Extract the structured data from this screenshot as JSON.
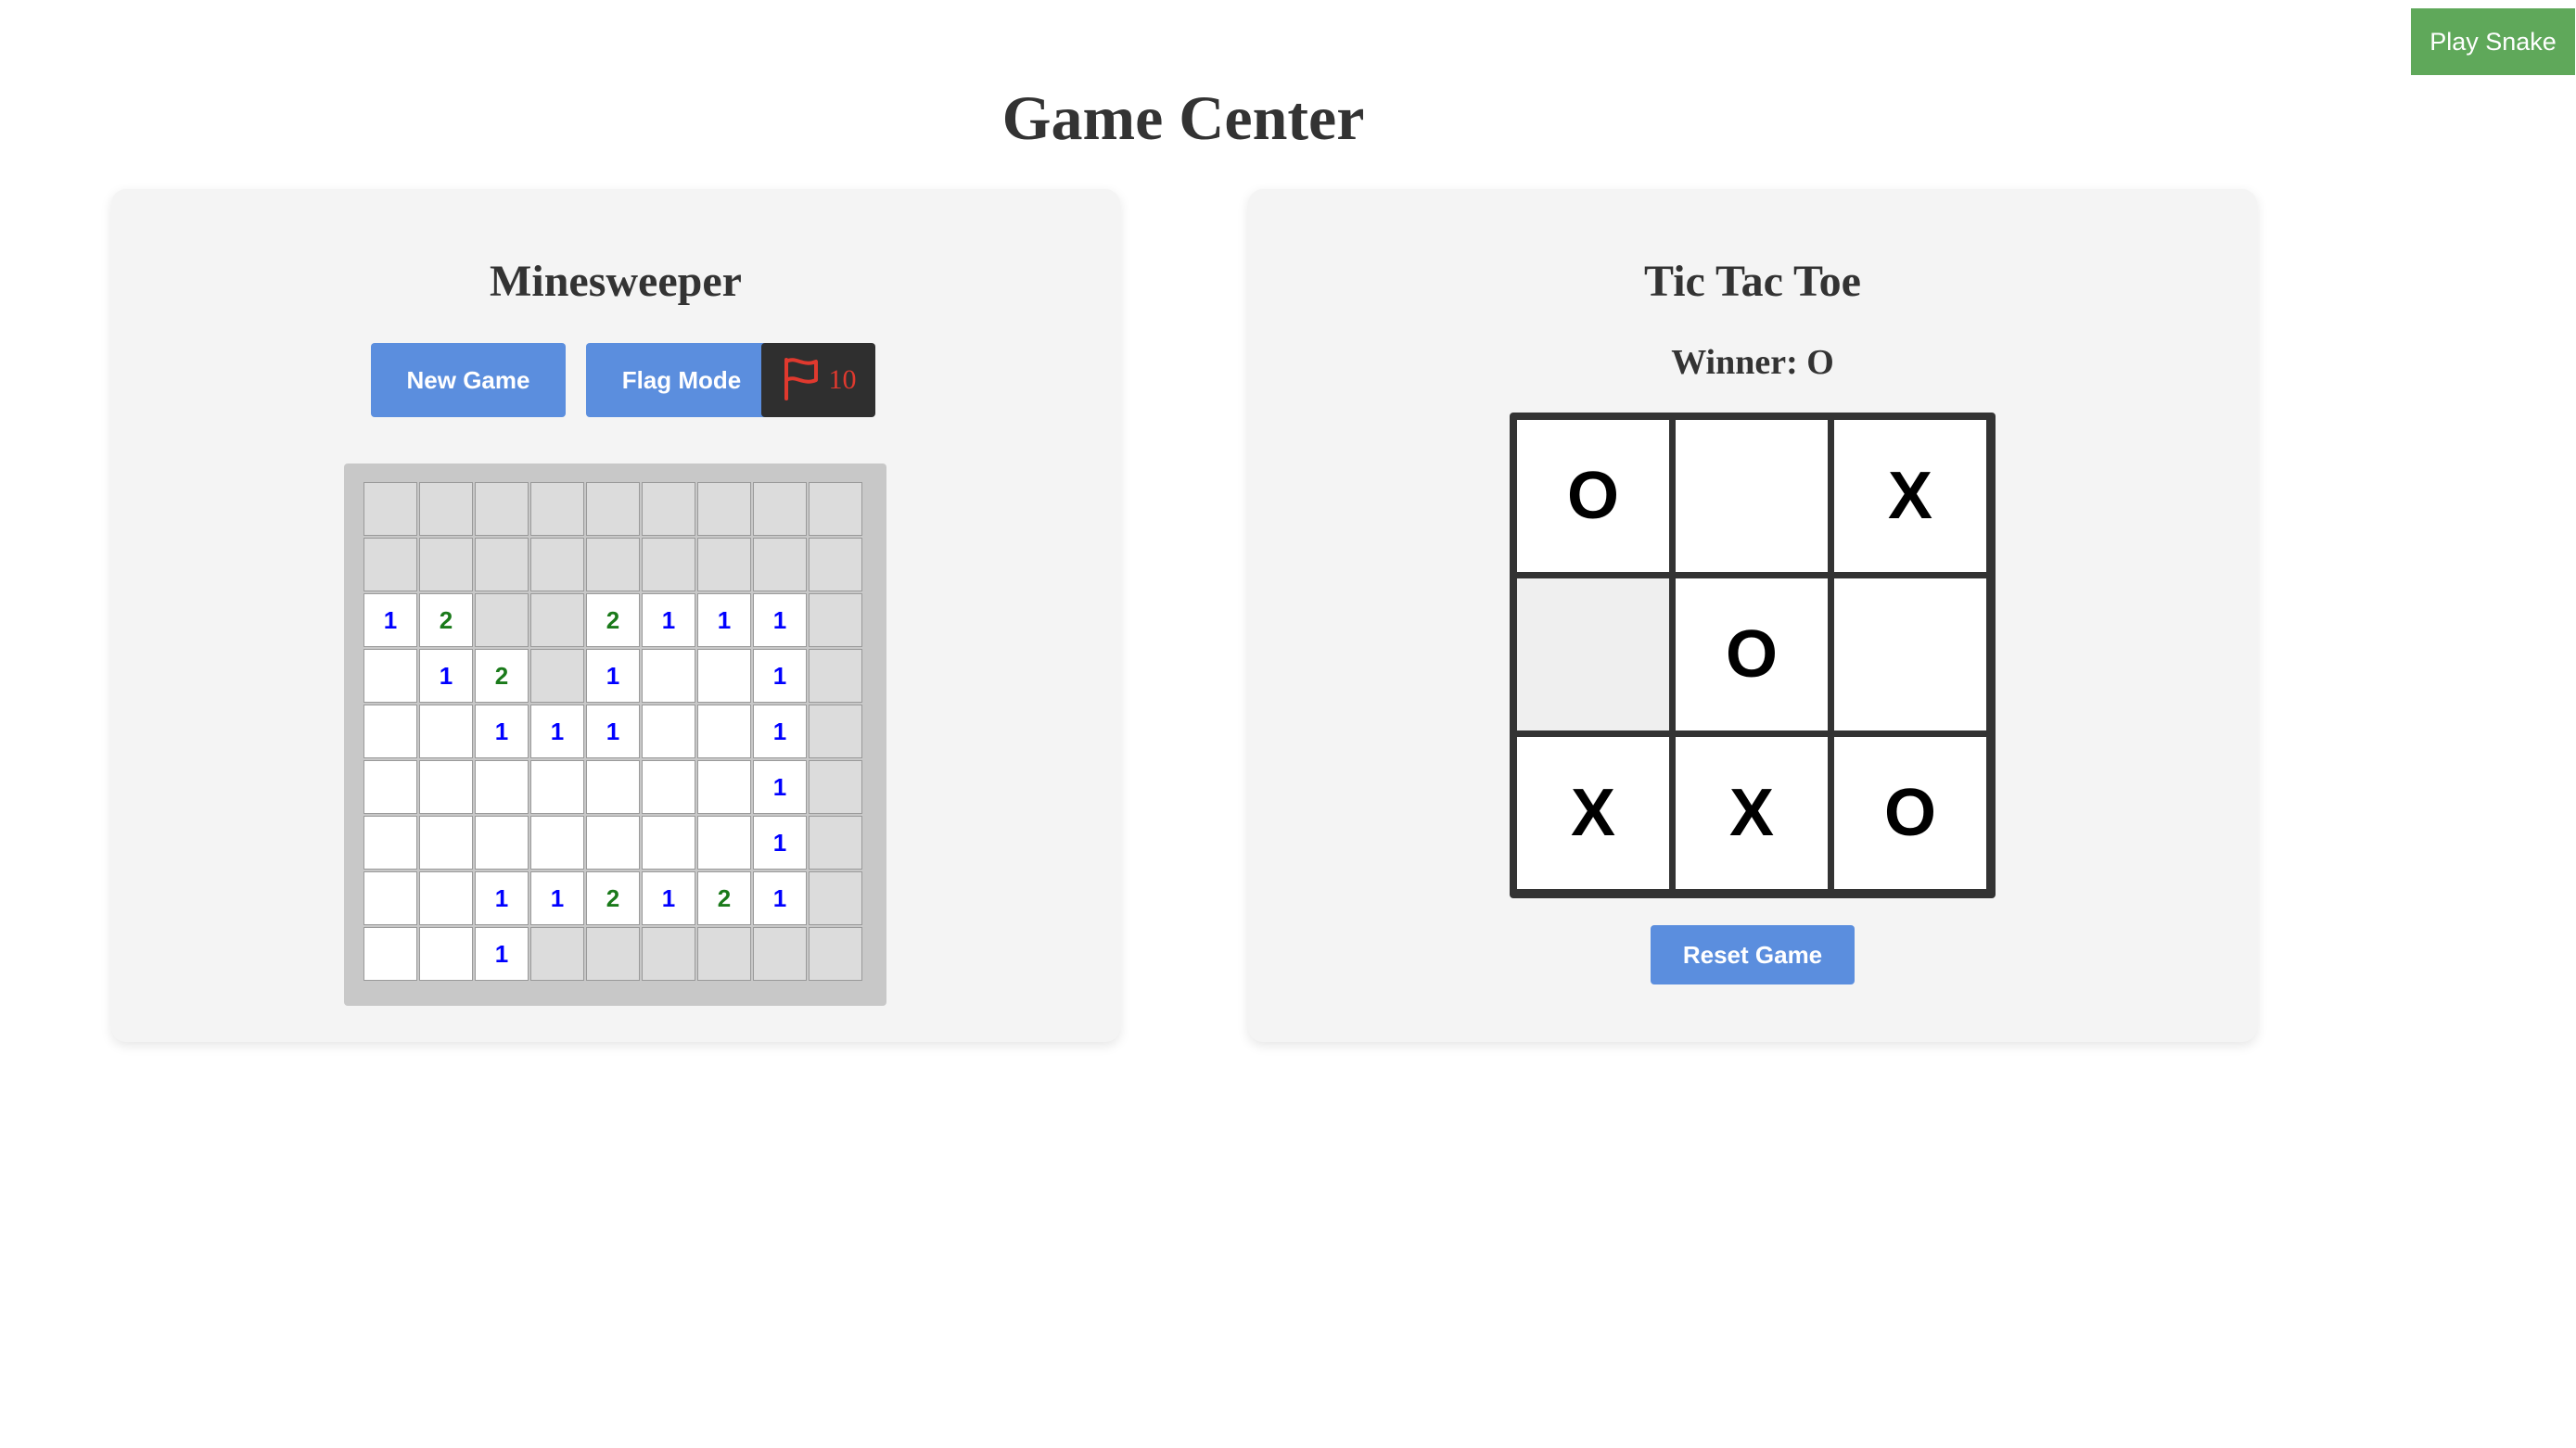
{
  "header": {
    "title": "Game Center",
    "play_snake_label": "Play Snake"
  },
  "minesweeper": {
    "title": "Minesweeper",
    "new_game_label": "New Game",
    "flag_mode_label": "Flag Mode",
    "flag_icon": "flag-icon",
    "flag_count": "10",
    "number_colors": {
      "1": "#0000ff",
      "2": "#1a7a1a"
    },
    "board": [
      [
        "h",
        "h",
        "h",
        "h",
        "h",
        "h",
        "h",
        "h",
        "h"
      ],
      [
        "h",
        "h",
        "h",
        "h",
        "h",
        "h",
        "h",
        "h",
        "h"
      ],
      [
        "1",
        "2",
        "h",
        "h",
        "2",
        "1",
        "1",
        "1",
        "h"
      ],
      [
        "",
        "1",
        "2",
        "h",
        "1",
        "",
        "",
        "1",
        "h"
      ],
      [
        "",
        "",
        "1",
        "1",
        "1",
        "",
        "",
        "1",
        "h"
      ],
      [
        "",
        "",
        "",
        "",
        "",
        "",
        "",
        "1",
        "h"
      ],
      [
        "",
        "",
        "",
        "",
        "",
        "",
        "",
        "1",
        "h"
      ],
      [
        "",
        "",
        "1",
        "1",
        "2",
        "1",
        "2",
        "1",
        "h"
      ],
      [
        "",
        "",
        "1",
        "h",
        "h",
        "h",
        "h",
        "h",
        "h"
      ]
    ]
  },
  "tictactoe": {
    "title": "Tic Tac Toe",
    "winner_text": "Winner: O",
    "board": [
      "O",
      "",
      "X",
      "",
      "O",
      "",
      "X",
      "X",
      "O"
    ],
    "reset_label": "Reset Game"
  },
  "colors": {
    "accent_blue": "#5b8ede",
    "snake_green": "#5fa85a",
    "flag_red": "#e0392e"
  }
}
